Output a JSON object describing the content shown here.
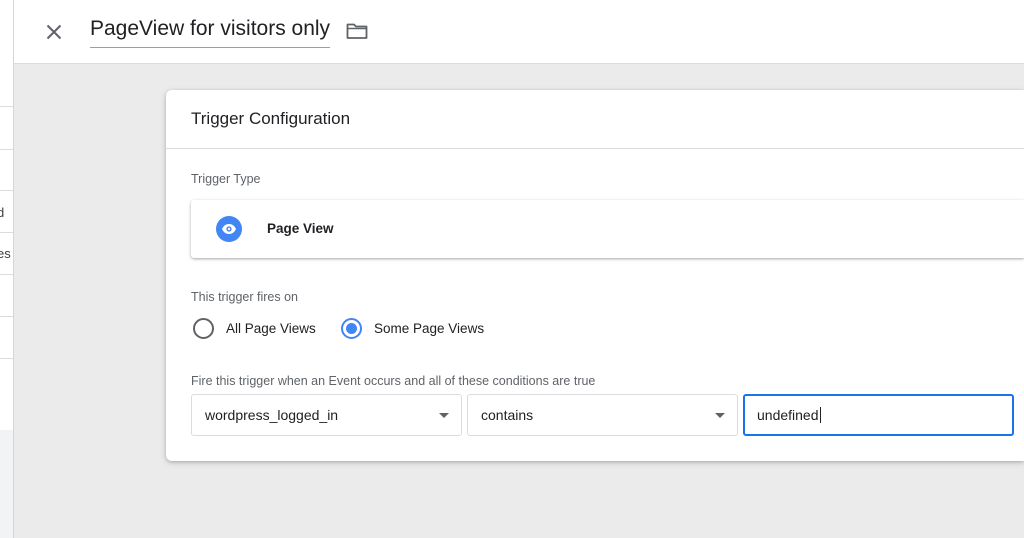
{
  "header": {
    "title": "PageView for visitors only"
  },
  "background": {
    "fragments": [
      "d",
      "es"
    ]
  },
  "card": {
    "title": "Trigger Configuration",
    "trigger_type_label": "Trigger Type",
    "trigger_type": "Page View",
    "fires_on_label": "This trigger fires on",
    "fires_on_options": [
      {
        "label": "All Page Views",
        "selected": false
      },
      {
        "label": "Some Page Views",
        "selected": true
      }
    ],
    "condition_label": "Fire this trigger when an Event occurs and all of these conditions are true",
    "condition": {
      "variable": "wordpress_logged_in",
      "operator": "contains",
      "value": "undefined"
    }
  },
  "colors": {
    "accent": "#4285f4",
    "focus": "#1a73e8",
    "page_background": "#ebebeb"
  },
  "icons": [
    "close-icon",
    "folder-icon",
    "eye-icon",
    "dropdown-arrow-icon"
  ]
}
